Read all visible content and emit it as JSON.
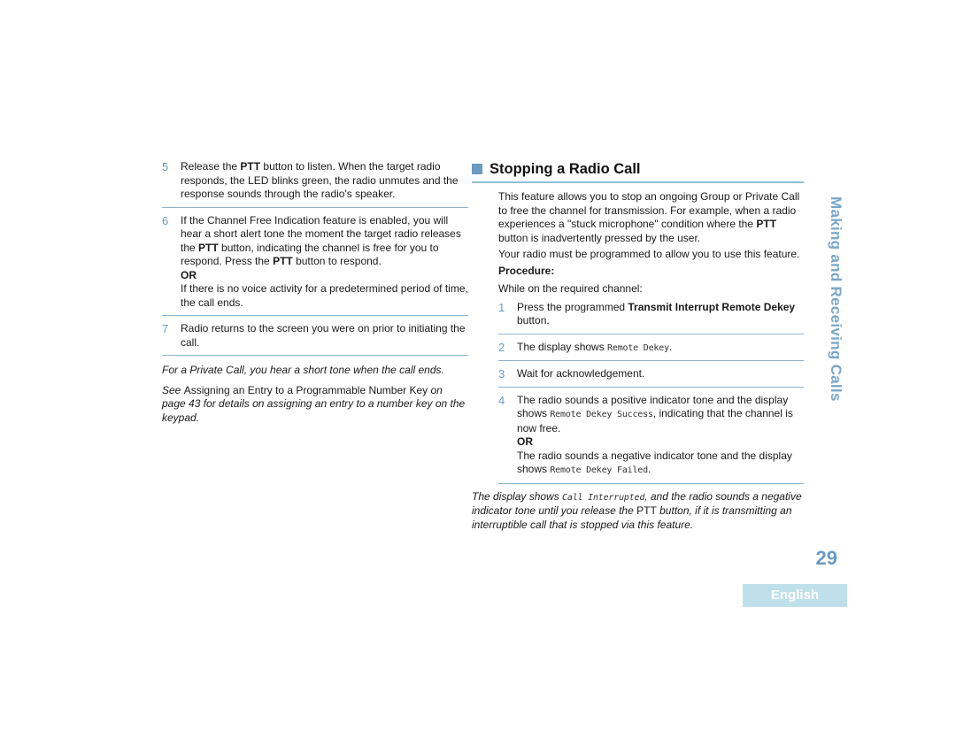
{
  "left_column": {
    "steps": [
      {
        "number": "5",
        "parts": [
          {
            "text": "Release the ",
            "bold": false
          },
          {
            "text": "PTT",
            "bold": true
          },
          {
            "text": " button to listen. When the target radio responds, the LED blinks green, the radio unmutes and the response sounds through the radio's speaker.",
            "bold": false
          }
        ]
      },
      {
        "number": "6",
        "parts": [
          {
            "text": "If the Channel Free Indication feature is enabled, you will hear a short alert tone the moment the target radio releases the ",
            "bold": false
          },
          {
            "text": "PTT",
            "bold": true
          },
          {
            "text": " button, indicating the channel is free for you to respond. Press the ",
            "bold": false
          },
          {
            "text": "PTT",
            "bold": true
          },
          {
            "text": " button to respond.",
            "bold": false
          }
        ],
        "or_label": "OR",
        "alternative": "If there is no voice activity for a predetermined period of time, the call ends."
      },
      {
        "number": "7",
        "parts": [
          {
            "text": "Radio returns to the screen you were on prior to initiating the call.",
            "bold": false
          }
        ]
      }
    ],
    "note_private_call": "For a Private Call, you hear a short tone when the call ends.",
    "note_see": {
      "prefix": "See ",
      "link_text": "Assigning an Entry to a Programmable Number Key",
      "suffix": " on page 43 for details on assigning an entry to a number key on the keypad."
    }
  },
  "right_column": {
    "heading": "Stopping a Radio Call",
    "intro_parts": [
      {
        "text": "This feature allows you to stop an ongoing Group or Private Call to free the channel for transmission. For example, when a radio experiences a \"stuck microphone\" condition where the ",
        "bold": false
      },
      {
        "text": "PTT",
        "bold": true
      },
      {
        "text": " button is inadvertently pressed by the user.",
        "bold": false
      }
    ],
    "programmed_note": "Your radio must be programmed to allow you to use this feature.",
    "procedure_label": "Procedure:",
    "procedure_intro": "While on the required channel:",
    "steps": [
      {
        "number": "1",
        "text_before": "Press the programmed ",
        "bold_text": "Transmit Interrupt Remote Dekey",
        "text_after": " button."
      },
      {
        "number": "2",
        "text_before": "The display shows ",
        "mono_text": "Remote Dekey",
        "text_after": "."
      },
      {
        "number": "3",
        "text_before": "Wait for acknowledgement."
      },
      {
        "number": "4",
        "text_before": "The radio sounds a positive indicator tone and the display shows ",
        "mono_text": "Remote Dekey Success",
        "text_after": ", indicating that the channel is now free.",
        "or_label": "OR",
        "alt_before": "The radio sounds a negative indicator tone and the display shows ",
        "alt_mono": "Remote Dekey Failed",
        "alt_after": "."
      }
    ],
    "closing_note": {
      "prefix": "The display shows ",
      "mono": "Call Interrupted",
      "middle": ", and the radio sounds a negative indicator tone until you release the ",
      "upright": "PTT",
      "suffix": " button, if it is transmitting an interruptible call that is stopped via this feature."
    }
  },
  "sidebar": {
    "chapter_title": "Making and Receiving Calls"
  },
  "footer": {
    "page_number": "29",
    "language_tab": "English"
  },
  "colors": {
    "accent_blue": "#6a9bc3",
    "rule_blue": "#8fc0cf",
    "language_tab_bg": "#bfe0ea"
  }
}
